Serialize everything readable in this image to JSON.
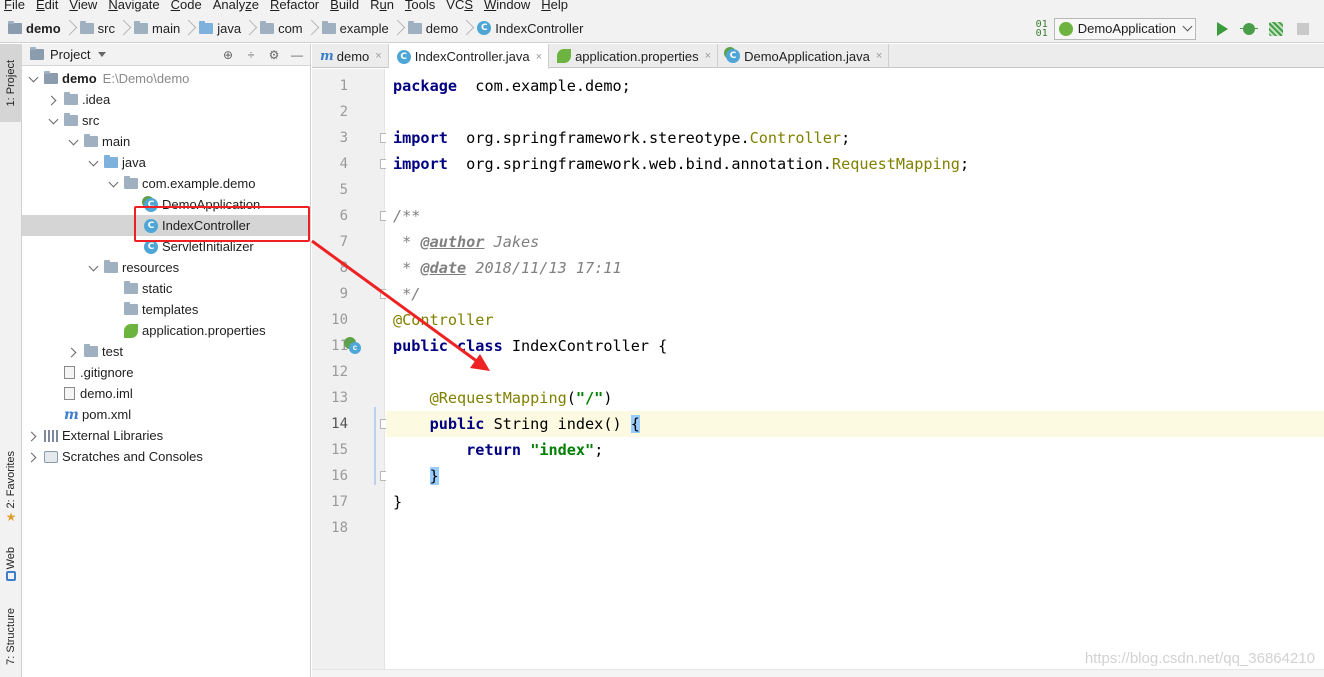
{
  "menu": [
    {
      "mn": "F",
      "rest": "ile"
    },
    {
      "mn": "E",
      "rest": "dit"
    },
    {
      "mn": "V",
      "rest": "iew"
    },
    {
      "mn": "N",
      "rest": "avigate"
    },
    {
      "mn": "C",
      "rest": "ode"
    },
    {
      "mn": "",
      "rest": "Analy",
      "mn2": "z",
      "rest2": "e"
    },
    {
      "mn": "R",
      "rest": "efactor"
    },
    {
      "mn": "B",
      "rest": "uild"
    },
    {
      "mn": "",
      "rest": "R",
      "mn2": "u",
      "rest2": "n"
    },
    {
      "mn": "T",
      "rest": "ools"
    },
    {
      "mn": "",
      "rest": "VC",
      "mn2": "S",
      "rest2": ""
    },
    {
      "mn": "W",
      "rest": "indow"
    },
    {
      "mn": "H",
      "rest": "elp"
    }
  ],
  "breadcrumb": [
    "demo",
    "src",
    "main",
    "java",
    "com",
    "example",
    "demo",
    "IndexController"
  ],
  "run": {
    "sort_icon": "01\n01",
    "config": "DemoApplication"
  },
  "left_strip": {
    "project": "1: Project",
    "favorites": "2: Favorites",
    "web": "Web",
    "structure": "7: Structure"
  },
  "project_panel": {
    "title": "Project",
    "tools": [
      "⊕",
      "÷",
      "⚙",
      "—"
    ]
  },
  "tree": [
    {
      "label": "demo",
      "hint": "E:\\Demo\\demo",
      "depth": 0,
      "caret": "down",
      "icon": "module",
      "bold": true
    },
    {
      "label": ".idea",
      "depth": 1,
      "caret": "right",
      "icon": "folder"
    },
    {
      "label": "src",
      "depth": 1,
      "caret": "down",
      "icon": "folder"
    },
    {
      "label": "main",
      "depth": 2,
      "caret": "down",
      "icon": "folder"
    },
    {
      "label": "java",
      "depth": 3,
      "caret": "down",
      "icon": "folder-blue"
    },
    {
      "label": "com.example.demo",
      "depth": 4,
      "caret": "down",
      "icon": "folder"
    },
    {
      "label": "DemoApplication",
      "depth": 5,
      "caret": "none",
      "icon": "class-spring"
    },
    {
      "label": "IndexController",
      "depth": 5,
      "caret": "none",
      "icon": "class",
      "selected": true
    },
    {
      "label": "ServletInitializer",
      "depth": 5,
      "caret": "none",
      "icon": "class"
    },
    {
      "label": "resources",
      "depth": 3,
      "caret": "down",
      "icon": "folder"
    },
    {
      "label": "static",
      "depth": 4,
      "caret": "none",
      "icon": "folder"
    },
    {
      "label": "templates",
      "depth": 4,
      "caret": "none",
      "icon": "folder"
    },
    {
      "label": "application.properties",
      "depth": 4,
      "caret": "none",
      "icon": "props"
    },
    {
      "label": "test",
      "depth": 2,
      "caret": "right",
      "icon": "folder"
    },
    {
      "label": ".gitignore",
      "depth": 1,
      "caret": "none",
      "icon": "file"
    },
    {
      "label": "demo.iml",
      "depth": 1,
      "caret": "none",
      "icon": "file"
    },
    {
      "label": "pom.xml",
      "depth": 1,
      "caret": "none",
      "icon": "maven"
    },
    {
      "label": "External Libraries",
      "depth": 0,
      "caret": "right",
      "icon": "lib"
    },
    {
      "label": "Scratches and Consoles",
      "depth": 0,
      "caret": "right",
      "icon": "scratch"
    }
  ],
  "tabs": [
    {
      "label": "demo",
      "icon": "maven",
      "active": false
    },
    {
      "label": "IndexController.java",
      "icon": "class",
      "active": true
    },
    {
      "label": "application.properties",
      "icon": "props",
      "active": false
    },
    {
      "label": "DemoApplication.java",
      "icon": "class-spring",
      "active": false
    }
  ],
  "tab_close": "×",
  "code_lines": [
    [
      [
        "kw",
        "package"
      ],
      [
        "",
        "  com.example.demo;"
      ]
    ],
    [],
    [
      [
        "kw",
        "import"
      ],
      [
        "",
        "  org.springframework.stereotype."
      ],
      [
        "cls",
        "Controller"
      ],
      [
        "",
        ";"
      ]
    ],
    [
      [
        "kw",
        "import"
      ],
      [
        "",
        "  org.springframework.web.bind.annotation."
      ],
      [
        "cls",
        "RequestMapping"
      ],
      [
        "",
        ";"
      ]
    ],
    [],
    [
      [
        "cm",
        "/**"
      ]
    ],
    [
      [
        "cm",
        " * "
      ],
      [
        "cmtag",
        "@author"
      ],
      [
        "cm",
        " Jakes"
      ]
    ],
    [
      [
        "cm",
        " * "
      ],
      [
        "cmtag",
        "@date"
      ],
      [
        "cm",
        " 2018/11/13 17:11"
      ]
    ],
    [
      [
        "cm",
        " */"
      ]
    ],
    [
      [
        "ann",
        "@Controller"
      ]
    ],
    [
      [
        "kw",
        "public class"
      ],
      [
        "",
        " IndexController {"
      ]
    ],
    [],
    [
      [
        "",
        "    "
      ],
      [
        "ann",
        "@RequestMapping"
      ],
      [
        "",
        "("
      ],
      [
        "str",
        "\"/\""
      ],
      [
        "",
        ")"
      ]
    ],
    [
      [
        "",
        "    "
      ],
      [
        "kw",
        "public"
      ],
      [
        "",
        " String index() "
      ],
      [
        "brace",
        "{"
      ]
    ],
    [
      [
        "",
        "        "
      ],
      [
        "kw",
        "return"
      ],
      [
        "",
        " "
      ],
      [
        "str",
        "\"index\""
      ],
      [
        "",
        ";"
      ]
    ],
    [
      [
        "",
        "    "
      ],
      [
        "brace",
        "}"
      ]
    ],
    [
      [
        "",
        "}"
      ]
    ],
    []
  ],
  "current_line": 14,
  "watermark": "https://blog.csdn.net/qq_36864210",
  "colors": {
    "highlight": "#ee2222",
    "keyword": "#000080",
    "annotation": "#808000",
    "string": "#008000"
  }
}
